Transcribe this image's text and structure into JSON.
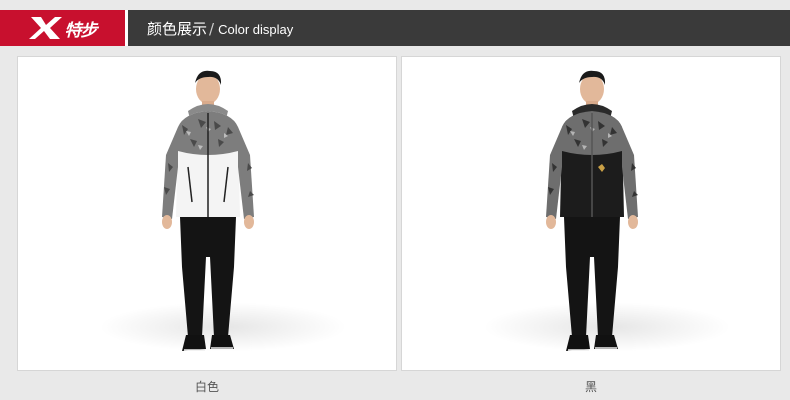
{
  "brand": {
    "logo_text": "特步",
    "accent": "#c8102e"
  },
  "header": {
    "title_cn": "颜色展示",
    "separator": "/",
    "title_en": "Color display"
  },
  "products": [
    {
      "caption": "白色",
      "body_color": "#f4f4f4"
    },
    {
      "caption": "黑",
      "body_color": "#1c1c1c"
    }
  ]
}
